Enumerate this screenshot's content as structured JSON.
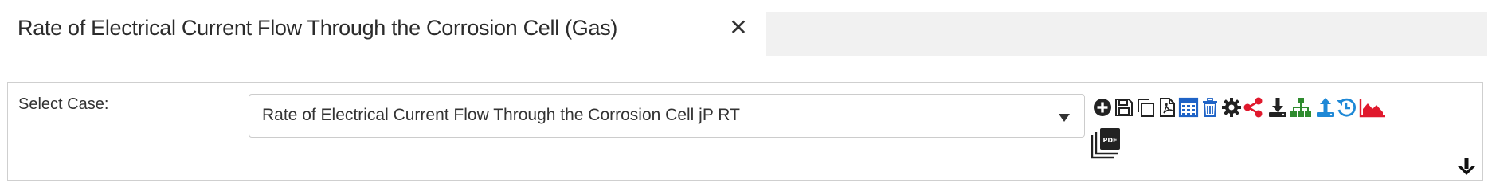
{
  "tab": {
    "title": "Rate of Electrical Current Flow Through the Corrosion Cell (Gas)",
    "close_glyph": "✕"
  },
  "form": {
    "select_case_label": "Select Case:",
    "selected_case": "Rate of Electrical Current Flow Through the Corrosion Cell jP RT"
  },
  "toolbar": {
    "icons": [
      "add-icon",
      "save-icon",
      "copy-icon",
      "pdf-icon",
      "calculator-icon",
      "delete-icon",
      "settings-icon",
      "share-icon",
      "download-icon",
      "sitemap-icon",
      "upload-icon",
      "history-icon",
      "area-chart-icon",
      "pdf-stack-icon",
      "arrow-down-icon"
    ],
    "colors": {
      "dark": "#222222",
      "blue": "#1f63c6",
      "red": "#e0192d",
      "green": "#2e8b2e",
      "light_blue": "#1e88d6"
    }
  }
}
